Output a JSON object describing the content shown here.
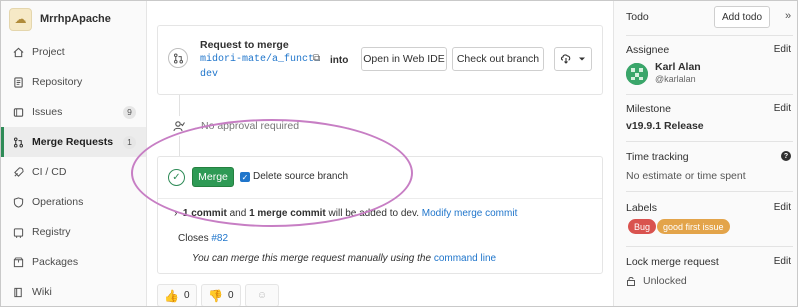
{
  "project": {
    "name": "MrrhpApache"
  },
  "sidebar": {
    "items": [
      {
        "label": "Project",
        "icon": "home-icon"
      },
      {
        "label": "Repository",
        "icon": "doc-icon"
      },
      {
        "label": "Issues",
        "icon": "issues-icon",
        "count": "9"
      },
      {
        "label": "Merge Requests",
        "icon": "merge-request-icon",
        "count": "1",
        "active": true
      },
      {
        "label": "CI / CD",
        "icon": "rocket-icon"
      },
      {
        "label": "Operations",
        "icon": "shield-icon"
      },
      {
        "label": "Registry",
        "icon": "container-icon"
      },
      {
        "label": "Packages",
        "icon": "package-icon"
      },
      {
        "label": "Wiki",
        "icon": "book-icon"
      }
    ]
  },
  "merge_widget": {
    "title": "Request to merge",
    "source_branch": "midori-mate/a_funct…",
    "into_label": "into",
    "target_branch": "dev",
    "open_ide_label": "Open in Web IDE",
    "checkout_label": "Check out branch",
    "approval_text": "No approval required",
    "merge_label": "Merge",
    "delete_branch_label": "Delete source branch",
    "commit_prefix": "1 commit",
    "commit_and": " and ",
    "commit_merge": "1 merge commit",
    "commit_suffix": " will be added to dev. ",
    "modify_link": "Modify merge commit",
    "closes_prefix": "Closes ",
    "closes_issue": "#82",
    "manual_text": "You can merge this merge request manually using the ",
    "command_line_link": "command line"
  },
  "reactions": {
    "thumbs_up_count": "0",
    "thumbs_down_count": "0"
  },
  "right_sidebar": {
    "todo_label": "Todo",
    "add_todo_label": "Add todo",
    "assignee_title": "Assignee",
    "edit_label": "Edit",
    "assignee_name": "Karl Alan",
    "assignee_handle": "@karlalan",
    "milestone_title": "Milestone",
    "milestone_value": "v19.9.1 Release",
    "time_tracking_title": "Time tracking",
    "time_tracking_value": "No estimate or time spent",
    "labels_title": "Labels",
    "labels": [
      "Bug",
      "good first issue"
    ],
    "lock_title": "Lock merge request",
    "lock_value": "Unlocked"
  },
  "colors": {
    "accent_green": "#2e9a55",
    "link_blue": "#1f75cb",
    "annotation_ellipse": "#c77ec4",
    "bug_label": "#d9534f",
    "good_first_issue_label": "#e3a44a"
  }
}
